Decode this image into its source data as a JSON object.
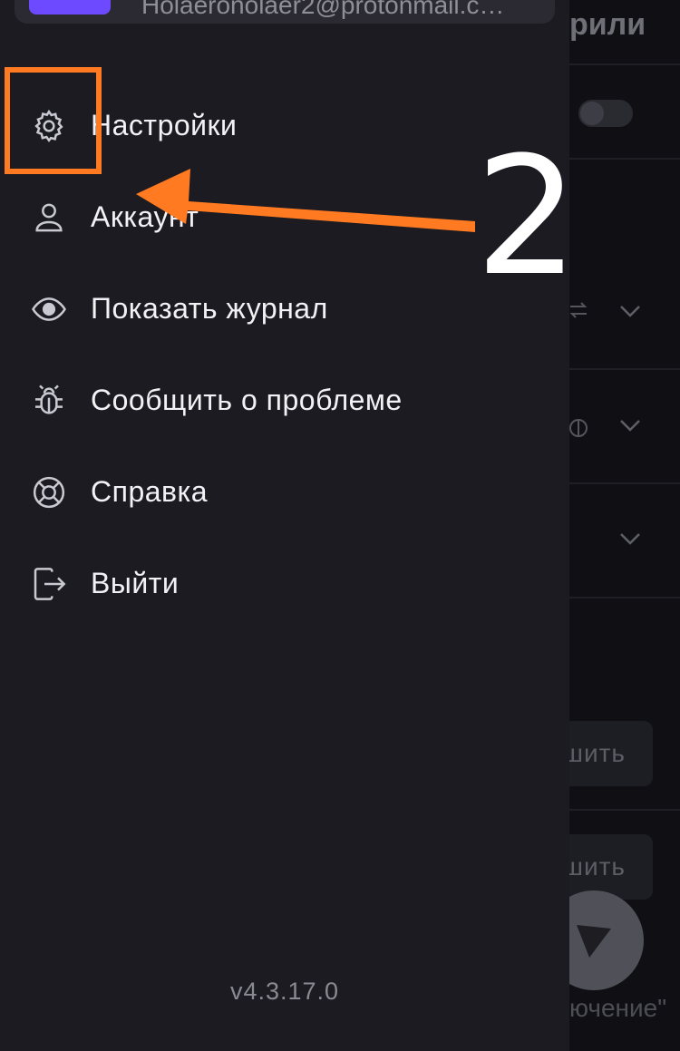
{
  "background": {
    "title_partial": "рили",
    "button1_partial": "шить",
    "button2_partial": "шить",
    "bottom_partial": "ючение\""
  },
  "drawer": {
    "account_email": "Holaeronolaer2@protonmail.c…",
    "menu": [
      {
        "label": "Настройки",
        "icon": "gear-icon"
      },
      {
        "label": "Аккаунт",
        "icon": "user-icon"
      },
      {
        "label": "Показать журнал",
        "icon": "eye-icon"
      },
      {
        "label": "Сообщить о проблеме",
        "icon": "bug-icon"
      },
      {
        "label": "Справка",
        "icon": "lifebuoy-icon"
      },
      {
        "label": "Выйти",
        "icon": "sign-out-icon"
      }
    ],
    "version": "v4.3.17.0"
  },
  "annotation": {
    "step_number": "2",
    "color": "#ff7a20"
  }
}
